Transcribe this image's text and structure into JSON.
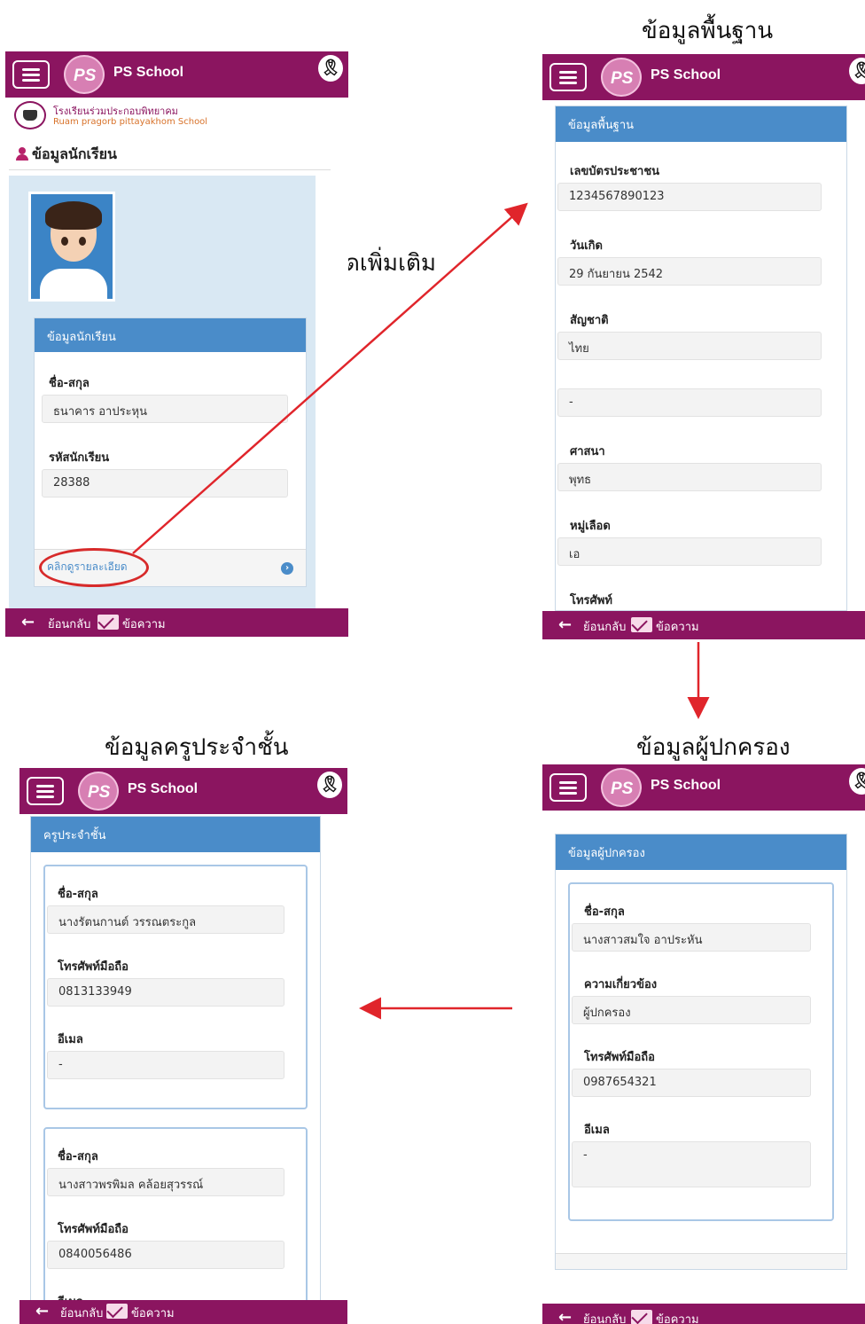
{
  "app": {
    "title": "PS School",
    "logo_text": "PS",
    "ribbon_icon": "awareness-ribbon-icon"
  },
  "school": {
    "name_th": "โรงเรียนร่วมประกอบพิทยาคม",
    "name_en": "Ruam pragorb pittayakhom School"
  },
  "nav": {
    "back": "ย้อนกลับ",
    "messages": "ข้อความ"
  },
  "captions": {
    "basic": "ข้อมูลพื้นฐาน",
    "click_hint": "คลิกเพื่อดูรายละเอียดเพิ่มเติม",
    "teacher": "ข้อมูลครูประจำชั้น",
    "parent": "ข้อมูลผู้ปกครอง"
  },
  "student_screen": {
    "heading": "ข้อมูลนักเรียน",
    "panel_title": "ข้อมูลนักเรียน",
    "fields": [
      {
        "label": "ชื่อ-สกุล",
        "value": "ธนาคาร อาประหุน"
      },
      {
        "label": "รหัสนักเรียน",
        "value": "28388"
      }
    ],
    "details_link": "คลิกดูรายละเอียด"
  },
  "basic_screen": {
    "panel_title": "ข้อมูลพื้นฐาน",
    "fields": [
      {
        "label": "เลขบัตรประชาชน",
        "value": "1234567890123"
      },
      {
        "label": "วันเกิด",
        "value": "29 กันยายน 2542"
      },
      {
        "label": "สัญชาติ",
        "value": "ไทย"
      },
      {
        "label": "",
        "value": "-"
      },
      {
        "label": "ศาสนา",
        "value": "พุทธ"
      },
      {
        "label": "หมู่เลือด",
        "value": "เอ"
      },
      {
        "label": "โทรศัพท์",
        "value": ""
      }
    ]
  },
  "parent_screen": {
    "panel_title": "ข้อมูลผู้ปกครอง",
    "fields": [
      {
        "label": "ชื่อ-สกุล",
        "value": "นางสาวสมใจ อาประหัน"
      },
      {
        "label": "ความเกี่ยวข้อง",
        "value": "ผู้ปกครอง"
      },
      {
        "label": "โทรศัพท์มือถือ",
        "value": "0987654321"
      },
      {
        "label": "อีเมล",
        "value": "-"
      }
    ]
  },
  "teacher_screen": {
    "panel_title": "ครูประจำชั้น",
    "teachers": [
      {
        "name_label": "ชื่อ-สกุล",
        "name": "นางรัตนกานต์ วรรณตระกูล",
        "phone_label": "โทรศัพท์มือถือ",
        "phone": "0813133949",
        "email_label": "อีเมล",
        "email": "-"
      },
      {
        "name_label": "ชื่อ-สกุล",
        "name": "นางสาวพรพิมล คล้อยสุวรรณ์",
        "phone_label": "โทรศัพท์มือถือ",
        "phone": "0840056486",
        "email_label": "อีเมล",
        "email": ""
      }
    ]
  },
  "colors": {
    "brand": "#8b1560",
    "panel_header": "#4a8cc9",
    "arrow": "#e0252b"
  }
}
